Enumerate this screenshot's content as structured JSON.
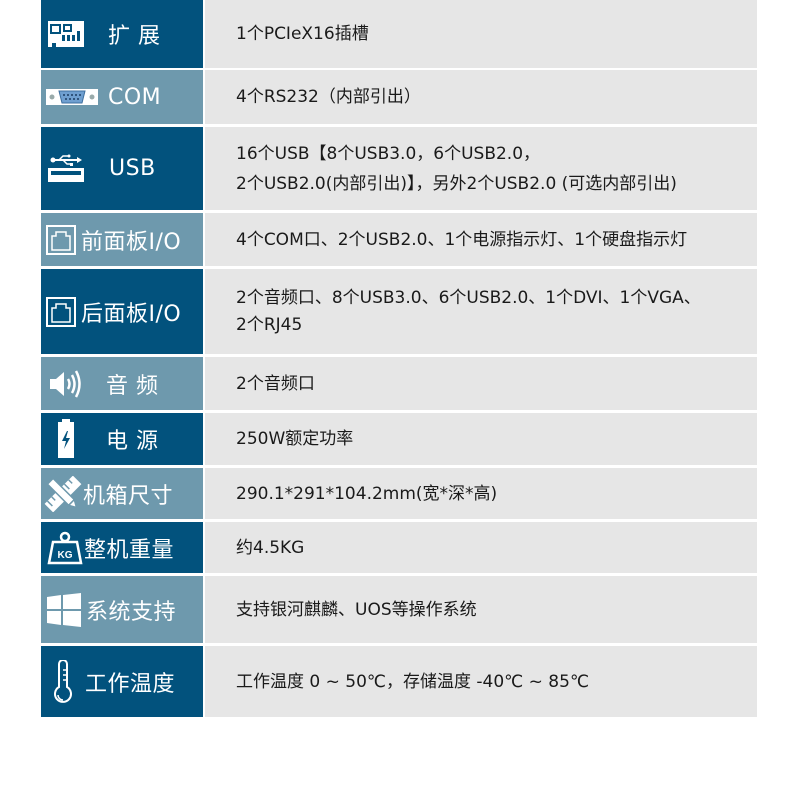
{
  "colors": {
    "label_dark": "#02527d",
    "label_light": "#6e99ad",
    "value_bg": "#e6e6e6",
    "value_text": "#1a1a1a"
  },
  "specs": [
    {
      "label": "扩展",
      "icon": "expansion-card-icon",
      "value_lines": [
        "1个PCIeX16插槽"
      ]
    },
    {
      "label": "COM",
      "icon": "serial-port-icon",
      "value_lines": [
        "4个RS232（内部引出）"
      ]
    },
    {
      "label": "USB",
      "icon": "usb-icon",
      "value_lines": [
        "16个USB【8个USB3.0，6个USB2.0，",
        "2个USB2.0(内部引出)】，另外2个USB2.0 (可选内部引出)"
      ]
    },
    {
      "label": "前面板I/O",
      "icon": "ethernet-port-icon",
      "value_lines": [
        "4个COM口、2个USB2.0、1个电源指示灯、1个硬盘指示灯"
      ]
    },
    {
      "label": "后面板I/O",
      "icon": "ethernet-port-icon",
      "value_lines": [
        "2个音频口、8个USB3.0、6个USB2.0、1个DVI、1个VGA、",
        "2个RJ45"
      ]
    },
    {
      "label": "音频",
      "icon": "speaker-icon",
      "value_lines": [
        "2个音频口"
      ]
    },
    {
      "label": "电源",
      "icon": "battery-icon",
      "value_lines": [
        "250W额定功率"
      ]
    },
    {
      "label": "机箱尺寸",
      "icon": "ruler-pencil-icon",
      "value_lines": [
        "290.1*291*104.2mm(宽*深*高)"
      ]
    },
    {
      "label": "整机重量",
      "icon": "weight-icon",
      "icon_text": "KG",
      "value_lines": [
        "约4.5KG"
      ]
    },
    {
      "label": "系统支持",
      "icon": "windows-icon",
      "value_lines": [
        "支持银河麒麟、UOS等操作系统"
      ]
    },
    {
      "label": "工作温度",
      "icon": "thermometer-icon",
      "value_lines": [
        "工作温度 0 ~ 50℃，存储温度 -40℃ ~ 85℃"
      ]
    }
  ]
}
